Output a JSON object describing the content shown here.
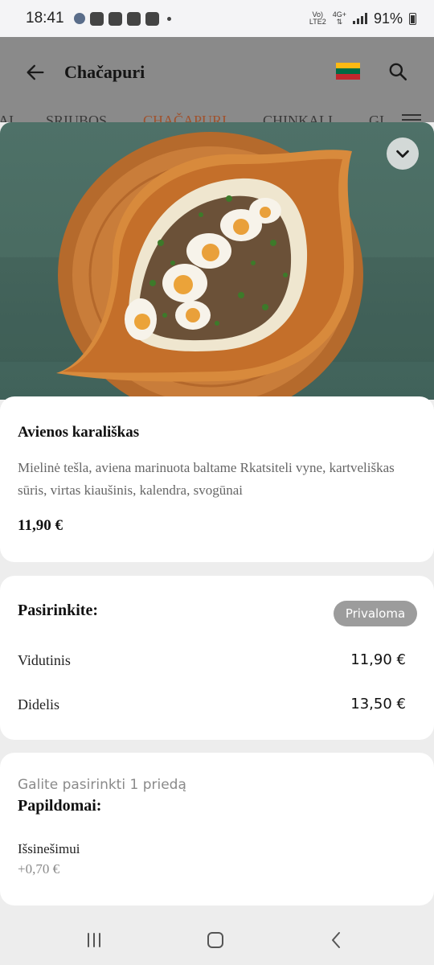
{
  "status_bar": {
    "time": "18:41",
    "network_top": "Vo)",
    "network_bottom": "LTE2",
    "network_gen": "4G+",
    "battery": "91%"
  },
  "header": {
    "title": "Chačapuri",
    "language_flag": "lithuania-flag",
    "flag_colors": [
      "#FDB913",
      "#006A44",
      "#C1272D"
    ]
  },
  "tabs": [
    {
      "label": "AI"
    },
    {
      "label": "SRIUBOS"
    },
    {
      "label": "CHAČAPURI"
    },
    {
      "label": "CHINKALI"
    },
    {
      "label": "GI"
    }
  ],
  "item": {
    "name": "Avienos karališkas",
    "description": "Mielinė tešla, aviena marinuota baltame Rkatsiteli vyne, kartveliškas sūris, virtas kiaušinis, kalendra, svogūnai",
    "price": "11,90 €"
  },
  "options": {
    "title": "Pasirinkite:",
    "badge": "Privaloma",
    "rows": [
      {
        "name": "Vidutinis",
        "price": "11,90 €"
      },
      {
        "name": "Didelis",
        "price": "13,50 €"
      }
    ]
  },
  "extras": {
    "hint": "Galite pasirinkti 1 priedą",
    "title": "Papildomai:",
    "rows": [
      {
        "name": "Išsinešimui",
        "price": "+0,70 €"
      }
    ]
  },
  "colors": {
    "accent_tab": "#a0522d",
    "badge_bg": "#9c9c9c",
    "hero_bg": "#4e7168"
  }
}
